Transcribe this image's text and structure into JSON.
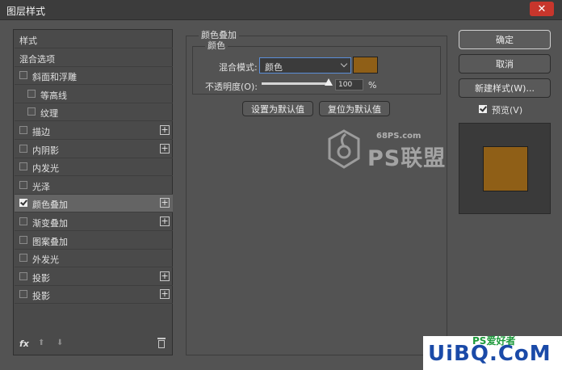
{
  "window": {
    "title": "图层样式",
    "close_glyph": "✕"
  },
  "left_panel": {
    "items": [
      {
        "label": "样式",
        "has_checkbox": false,
        "checked": false,
        "indent": 0,
        "has_plus": false,
        "selected": false
      },
      {
        "label": "混合选项",
        "has_checkbox": false,
        "checked": false,
        "indent": 0,
        "has_plus": false,
        "selected": false
      },
      {
        "label": "斜面和浮雕",
        "has_checkbox": true,
        "checked": false,
        "indent": 0,
        "has_plus": false,
        "selected": false
      },
      {
        "label": "等高线",
        "has_checkbox": true,
        "checked": false,
        "indent": 1,
        "has_plus": false,
        "selected": false
      },
      {
        "label": "纹理",
        "has_checkbox": true,
        "checked": false,
        "indent": 1,
        "has_plus": false,
        "selected": false
      },
      {
        "label": "描边",
        "has_checkbox": true,
        "checked": false,
        "indent": 0,
        "has_plus": true,
        "selected": false
      },
      {
        "label": "内阴影",
        "has_checkbox": true,
        "checked": false,
        "indent": 0,
        "has_plus": true,
        "selected": false
      },
      {
        "label": "内发光",
        "has_checkbox": true,
        "checked": false,
        "indent": 0,
        "has_plus": false,
        "selected": false
      },
      {
        "label": "光泽",
        "has_checkbox": true,
        "checked": false,
        "indent": 0,
        "has_plus": false,
        "selected": false
      },
      {
        "label": "颜色叠加",
        "has_checkbox": true,
        "checked": true,
        "indent": 0,
        "has_plus": true,
        "selected": true
      },
      {
        "label": "渐变叠加",
        "has_checkbox": true,
        "checked": false,
        "indent": 0,
        "has_plus": true,
        "selected": false
      },
      {
        "label": "图案叠加",
        "has_checkbox": true,
        "checked": false,
        "indent": 0,
        "has_plus": false,
        "selected": false
      },
      {
        "label": "外发光",
        "has_checkbox": true,
        "checked": false,
        "indent": 0,
        "has_plus": false,
        "selected": false
      },
      {
        "label": "投影",
        "has_checkbox": true,
        "checked": false,
        "indent": 0,
        "has_plus": true,
        "selected": false
      },
      {
        "label": "投影",
        "has_checkbox": true,
        "checked": false,
        "indent": 0,
        "has_plus": true,
        "selected": false
      }
    ],
    "plus_glyph": "+",
    "footer": {
      "fx_label": "fx",
      "up_glyph": "⬆",
      "down_glyph": "⬇",
      "trash_icon": "trash-icon"
    }
  },
  "color_overlay": {
    "section_title": "颜色叠加",
    "group_title": "颜色",
    "blend_mode_label": "混合模式:",
    "blend_mode_value": "颜色",
    "overlay_color": "#8f5f17",
    "opacity_label": "不透明度(O):",
    "opacity_value": "100",
    "opacity_unit": "%",
    "opacity_fraction": 1.0,
    "set_default_label": "设置为默认值",
    "reset_default_label": "复位为默认值"
  },
  "right_panel": {
    "ok_label": "确定",
    "cancel_label": "取消",
    "new_style_label": "新建样式(W)...",
    "preview_label": "预览(V)",
    "preview_checked": true
  },
  "watermark": {
    "site": "68PS.com",
    "brand": "PS联盟",
    "corner_small": "PS爱好者",
    "corner_big": "UiBQ.CoM"
  }
}
